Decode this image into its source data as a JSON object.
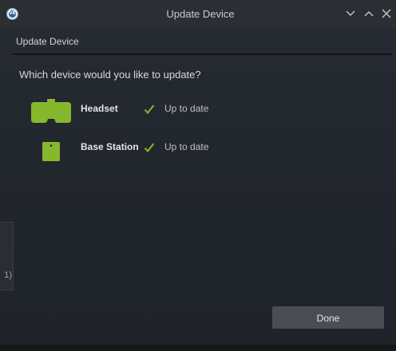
{
  "window": {
    "title": "Update Device",
    "app_icon": "steamvr-logo",
    "app_icon_text": "VR",
    "controls": [
      "chevron-down-icon",
      "chevron-up-icon",
      "close-icon"
    ]
  },
  "dialog": {
    "header": "Update Device",
    "question": "Which device would you like to update?",
    "devices": [
      {
        "name": "Headset",
        "icon": "headset-icon",
        "status": "Up to date",
        "status_icon": "checkmark-icon"
      },
      {
        "name": "Base Station",
        "icon": "base-station-icon",
        "status": "Up to date",
        "status_icon": "checkmark-icon"
      }
    ],
    "done_label": "Done"
  },
  "background_window": {
    "partial_text": "1)"
  },
  "colors": {
    "accent_green": "#86b82e",
    "titlebar": "#2b2e33",
    "panel": "#22262d",
    "button": "#4a4d52"
  }
}
